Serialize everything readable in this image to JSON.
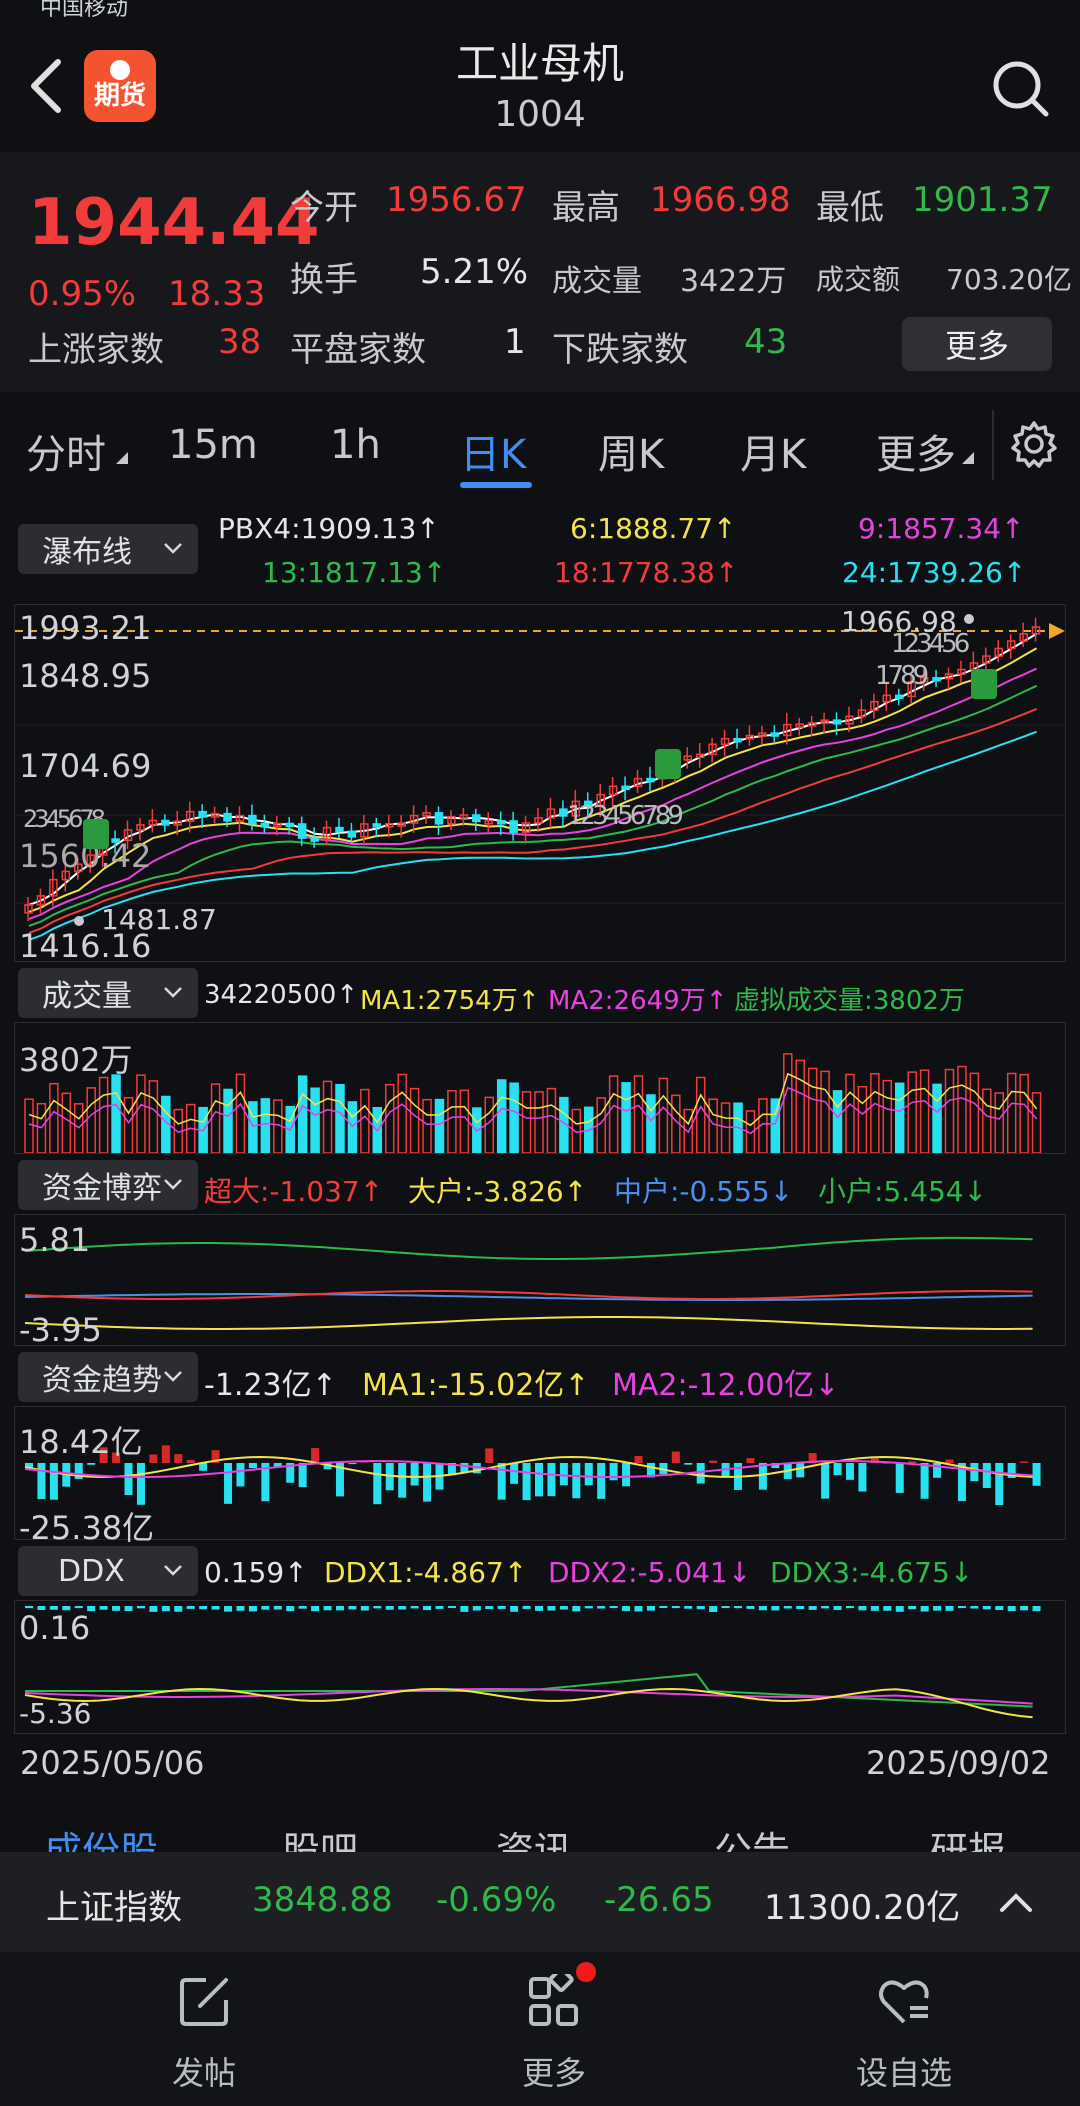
{
  "status": {
    "carrier": "中国移动"
  },
  "header": {
    "title": "工业母机",
    "code": "1004",
    "logo_text": "期货"
  },
  "quote": {
    "price": "1944.44",
    "change_pct": "0.95%",
    "change": "18.33",
    "open_label": "今开",
    "open": "1956.67",
    "high_label": "最高",
    "high": "1966.98",
    "low_label": "最低",
    "low": "1901.37",
    "turnover_label": "换手",
    "turnover": "5.21%",
    "volume_label": "成交量",
    "volume": "3422万",
    "amount_label": "成交额",
    "amount": "703.20亿",
    "up_label": "上涨家数",
    "up": "38",
    "flat_label": "平盘家数",
    "flat": "1",
    "down_label": "下跌家数",
    "down": "43",
    "more_label": "更多"
  },
  "tabs": [
    {
      "label": "分时"
    },
    {
      "label": "15m"
    },
    {
      "label": "1h"
    },
    {
      "label": "日K"
    },
    {
      "label": "周K"
    },
    {
      "label": "月K"
    },
    {
      "label": "更多"
    }
  ],
  "main_indicator": {
    "selector": "瀑布线",
    "pbx4": "PBX4:1909.13↑",
    "l6": "6:1888.77↑",
    "l9": "9:1857.34↑",
    "l13": "13:1817.13↑",
    "l18": "18:1778.38↑",
    "l24": "24:1739.26↑"
  },
  "price_axis": {
    "y1": "1993.21",
    "y2": "1848.95",
    "y3": "1704.69",
    "y4": "1560.42",
    "y5": "1416.16",
    "high_mark": "1966.98",
    "low_mark": "1481.87",
    "seq_left": "2345678",
    "seq_mid": "123456789",
    "seq_right": "123456",
    "seq_right2": "1789"
  },
  "volume": {
    "selector": "成交量",
    "value": "34220500↑",
    "ma1": "MA1:2754万↑",
    "ma2": "MA2:2649万↑",
    "virtual": "虚拟成交量:3802万",
    "axis_top": "3802万"
  },
  "fund_game": {
    "selector": "资金博弈",
    "super": "超大:-1.037↑",
    "large": "大户:-3.826↑",
    "mid": "中户:-0.555↓",
    "small": "小户:5.454↓",
    "axis_top": "5.81",
    "axis_bottom": "-3.95"
  },
  "fund_trend": {
    "selector": "资金趋势",
    "value": "-1.23亿↑",
    "ma1": "MA1:-15.02亿↑",
    "ma2": "MA2:-12.00亿↓",
    "axis_top": "18.42亿",
    "axis_bottom": "-25.38亿"
  },
  "ddx": {
    "selector": "DDX",
    "value": "0.159↑",
    "ddx1": "DDX1:-4.867↑",
    "ddx2": "DDX2:-5.041↓",
    "ddx3": "DDX3:-4.675↓",
    "axis_top": "0.16",
    "axis_bottom": "-5.36"
  },
  "dates": {
    "start": "2025/05/06",
    "end": "2025/09/02"
  },
  "bottom_tabs": [
    {
      "label": "成份股"
    },
    {
      "label": "股吧"
    },
    {
      "label": "资讯"
    },
    {
      "label": "公告"
    },
    {
      "label": "研报"
    }
  ],
  "index_bar": {
    "name": "上证指数",
    "value": "3848.88",
    "pct": "-0.69%",
    "change": "-26.65",
    "amount": "11300.20亿"
  },
  "nav": [
    {
      "label": "发帖"
    },
    {
      "label": "更多"
    },
    {
      "label": "设自选"
    }
  ],
  "colors": {
    "up": "#f23b3b",
    "down": "#2fb84c",
    "accent": "#3f8ff0",
    "cyan": "#28e0f0"
  }
}
